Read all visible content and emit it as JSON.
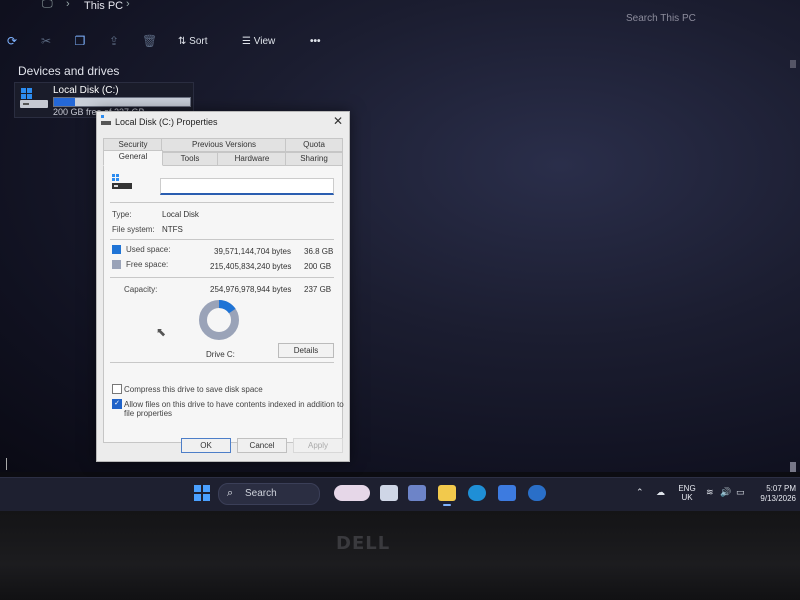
{
  "explorer": {
    "breadcrumb": "This PC",
    "search_placeholder": "Search This PC",
    "toolbar": {
      "sort_label": "Sort",
      "view_label": "View",
      "more_label": "•••"
    },
    "section_title": "Devices and drives",
    "drive": {
      "name": "Local Disk (C:)",
      "free_text": "200 GB free of 237 GB",
      "used_fraction": 0.155
    }
  },
  "dialog": {
    "title": "Local Disk (C:) Properties",
    "close_label": "✕",
    "tabs_row1": [
      "Security",
      "Previous Versions",
      "Quota"
    ],
    "tabs_row2": [
      "General",
      "Tools",
      "Hardware",
      "Sharing"
    ],
    "active_tab": "General",
    "name_value": "",
    "type_label": "Type:",
    "type_value": "Local Disk",
    "fs_label": "File system:",
    "fs_value": "NTFS",
    "used": {
      "label": "Used space:",
      "bytes": "39,571,144,704 bytes",
      "size": "36.8 GB",
      "color": "#1f74d6"
    },
    "free": {
      "label": "Free space:",
      "bytes": "215,405,834,240 bytes",
      "size": "200 GB",
      "color": "#9aa3b8"
    },
    "capacity": {
      "label": "Capacity:",
      "bytes": "254,976,978,944 bytes",
      "size": "237 GB"
    },
    "used_fraction": 0.155,
    "drive_label": "Drive C:",
    "details_label": "Details",
    "compress_label": "Compress this drive to save disk space",
    "compress_checked": false,
    "index_label_line1": "Allow files on this drive to have contents indexed in addition to",
    "index_label_line2": "file properties",
    "index_checked": true,
    "ok_label": "OK",
    "cancel_label": "Cancel",
    "apply_label": "Apply"
  },
  "taskbar": {
    "search_label": "Search",
    "lang_line1": "ENG",
    "lang_line2": "UK",
    "time": "5:07 PM",
    "date": "9/13/2026"
  },
  "bezel": {
    "brand": "DELL"
  }
}
